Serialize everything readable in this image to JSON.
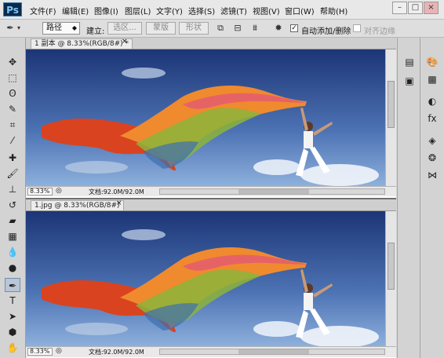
{
  "app": {
    "logo": "Ps"
  },
  "menus": [
    "文件(F)",
    "编辑(E)",
    "图像(I)",
    "图层(L)",
    "文字(Y)",
    "选择(S)",
    "滤镜(T)",
    "视图(V)",
    "窗口(W)",
    "帮助(H)"
  ],
  "window_controls": {
    "minimize": "–",
    "maximize": "□",
    "close": "×"
  },
  "options": {
    "mode_select": "路径",
    "build_label": "建立:",
    "selection_btn": "选区...",
    "mask_btn": "蒙版",
    "shape_btn": "形状",
    "auto_add_delete": "自动添加/删除",
    "align_edges": "对齐边缘"
  },
  "documents": [
    {
      "tab": "1 副本 @ 8.33%(RGB/8#) *",
      "zoom": "8.33%",
      "info": "文档:92.0M/92.0M"
    },
    {
      "tab": "1.jpg @ 8.33%(RGB/8#)",
      "zoom": "8.33%",
      "info": "文档:92.0M/92.0M"
    }
  ],
  "tools": [
    "move-tool",
    "marquee-tool",
    "lasso-tool",
    "quick-select-tool",
    "crop-tool",
    "eyedropper-tool",
    "healing-brush-tool",
    "brush-tool",
    "clone-stamp-tool",
    "history-brush-tool",
    "eraser-tool",
    "gradient-tool",
    "blur-tool",
    "dodge-tool",
    "pen-tool",
    "type-tool",
    "path-select-tool",
    "shape-tool",
    "hand-tool",
    "zoom-tool"
  ],
  "colors": {
    "sky_top": "#1e3a78",
    "sky_bottom": "#6e93c9",
    "scarf_red": "#d9431f",
    "scarf_orange": "#f08a2e",
    "scarf_green": "#8cb43a"
  }
}
